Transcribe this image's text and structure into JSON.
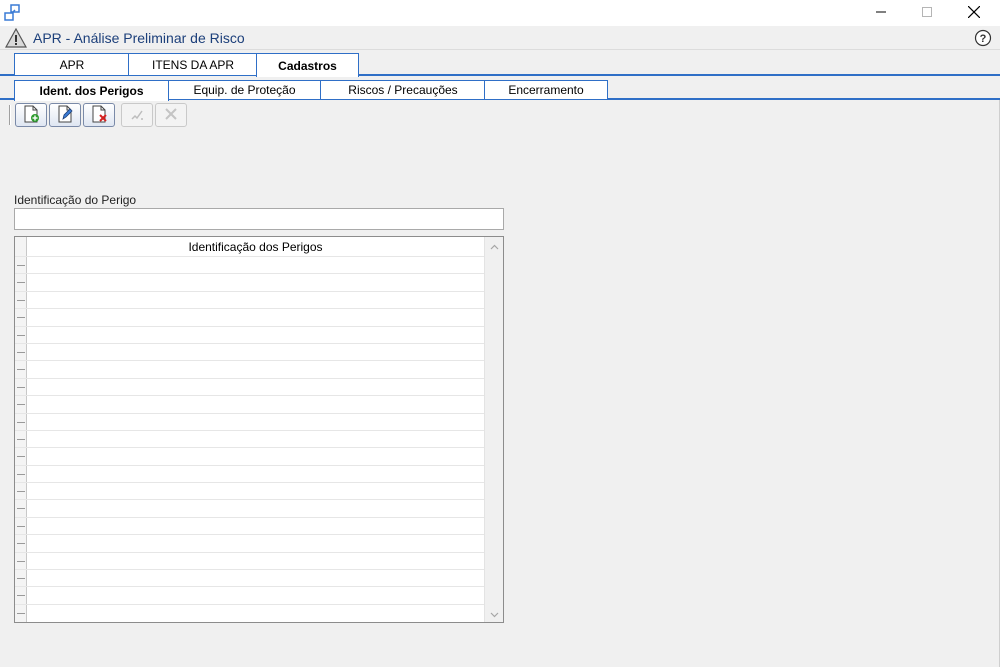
{
  "window": {
    "icon": "restore-window-icon",
    "controls": {
      "minimize": "minimize-icon",
      "maximize": "maximize-icon",
      "close": "close-icon"
    }
  },
  "header": {
    "title": "APR - Análise Preliminar de Risco",
    "icon": "warning-icon",
    "help_icon": "help-icon"
  },
  "tabs": [
    {
      "label": "APR",
      "active": false
    },
    {
      "label": "ITENS DA APR",
      "active": false
    },
    {
      "label": "Cadastros",
      "active": true
    }
  ],
  "subtabs": [
    {
      "label": "Ident. dos Perigos",
      "active": true
    },
    {
      "label": "Equip. de Proteção",
      "active": false
    },
    {
      "label": "Riscos / Precauções",
      "active": false
    },
    {
      "label": "Encerramento",
      "active": false
    }
  ],
  "toolbar": {
    "buttons": [
      {
        "icon": "new-record-icon",
        "enabled": true
      },
      {
        "icon": "edit-record-icon",
        "enabled": true
      },
      {
        "icon": "delete-record-icon",
        "enabled": true
      },
      {
        "icon": "save-record-icon",
        "enabled": false
      },
      {
        "icon": "cancel-record-icon",
        "enabled": false
      }
    ]
  },
  "form": {
    "label": "Identificação do Perigo",
    "value": ""
  },
  "grid": {
    "columns": [
      "Identificação dos Perigos"
    ],
    "rows": []
  },
  "colors": {
    "accent": "#2f6fc7",
    "title_text": "#1c3f7a",
    "background": "#f0f0f0"
  }
}
